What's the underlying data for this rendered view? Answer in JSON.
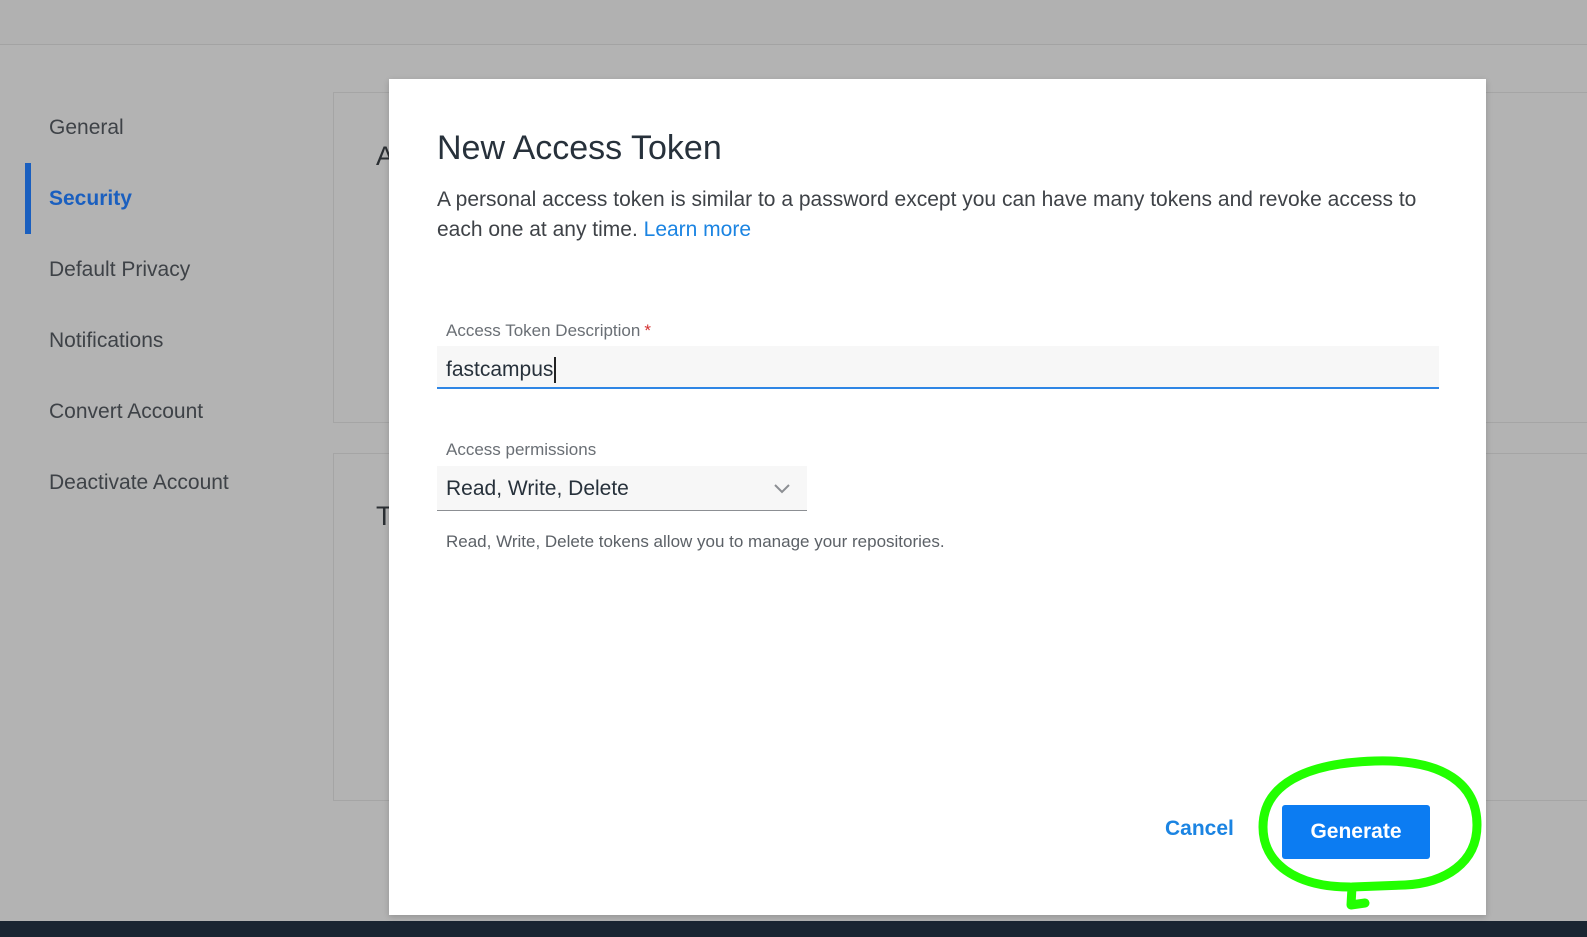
{
  "sidebar": {
    "items": [
      {
        "label": "General"
      },
      {
        "label": "Security"
      },
      {
        "label": "Default Privacy"
      },
      {
        "label": "Notifications"
      },
      {
        "label": "Convert Account"
      },
      {
        "label": "Deactivate Account"
      }
    ],
    "active": "Security"
  },
  "background": {
    "card1_letter": "A",
    "card2_letter": "T"
  },
  "modal": {
    "title": "New Access Token",
    "description": "A personal access token is similar to a password except you can have many tokens and revoke access to each one at any time.",
    "learn_more": "Learn more",
    "description_label": "Access Token Description",
    "required_mark": "*",
    "description_value": "fastcampus",
    "permissions_label": "Access permissions",
    "permissions_value": "Read, Write, Delete",
    "permissions_help": "Read, Write, Delete tokens allow you to manage your repositories.",
    "cancel_label": "Cancel",
    "generate_label": "Generate"
  },
  "icons": {
    "select_chevron": "chevron-down-icon"
  },
  "colors": {
    "accent": "#0c7cf2",
    "link": "#1b84e2",
    "sidebar_active": "#1a5fbf",
    "highlight": "#22ff00"
  }
}
